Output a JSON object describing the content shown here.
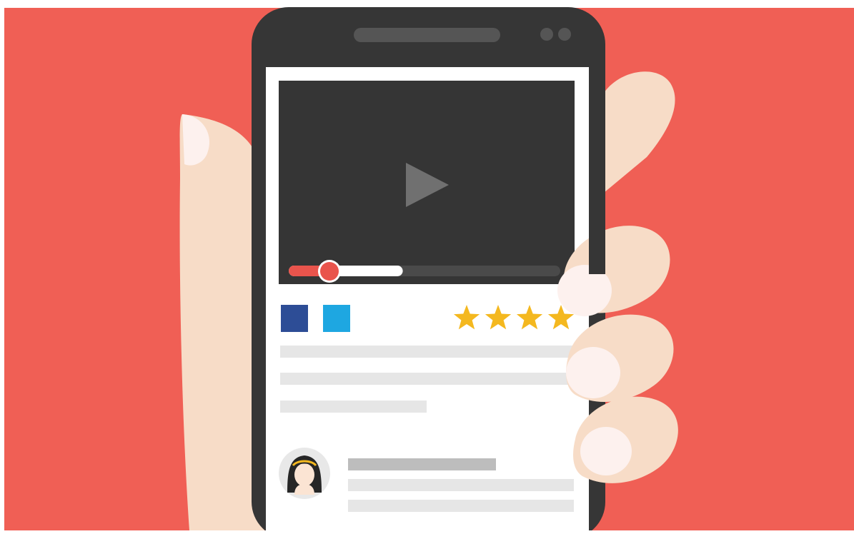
{
  "scene": {
    "description_colors": {
      "background": "#F05F55",
      "frame": "#FFFFFF",
      "phone_body": "#363636",
      "screen": "#FFFFFF",
      "video_area": "#353535",
      "skin": "#F7DCC7",
      "nail": "#FDF1EE",
      "play_icon": "#707070",
      "progress_played": "#E9544C",
      "progress_buffered": "#FFFFFF",
      "progress_track": "#4A4A4A",
      "social_1": "#2D4D96",
      "social_2": "#1EA7E1",
      "star": "#F4B81F",
      "placeholder_line": "#E6E6E6",
      "placeholder_line_dark": "#BDBDBD",
      "avatar_ring": "#E8E8E8",
      "avatar_hair": "#262626",
      "headband": "#F4B81F"
    }
  },
  "video": {
    "progress": {
      "played_fraction": 0.15,
      "buffered_fraction": 0.42
    },
    "icons": {
      "play": "play-icon"
    }
  },
  "social": {
    "icons": [
      "facebook-icon",
      "twitter-icon"
    ]
  },
  "rating": {
    "visible_stars": 4,
    "icon": "star-icon"
  }
}
